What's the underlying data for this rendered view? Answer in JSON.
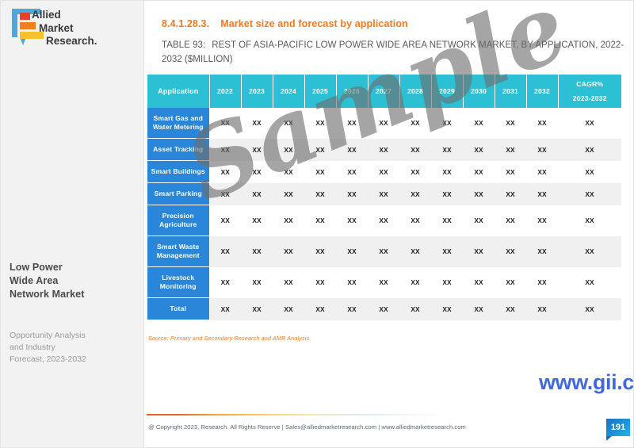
{
  "sidebar": {
    "logo": {
      "line1": "Allied",
      "line2": "Market",
      "line3": "Research."
    },
    "report_title_line1": "Low Power",
    "report_title_line2": "Wide Area",
    "report_title_line3": "Network Market",
    "report_subtitle_line1": "Opportunity Analysis",
    "report_subtitle_line2": "and Industry",
    "report_subtitle_line3": "Forecast, 2023-2032"
  },
  "main": {
    "section_number": "8.4.1.28.3.",
    "section_title": "Market size and forecast by application",
    "table_number": "TABLE 93:",
    "table_caption": "REST OF ASIA-PACIFIC LOW POWER WIDE AREA NETWORK MARKET, BY APPLICATION, 2022-2032 ($MILLION)",
    "source_note": "Source: Primary and Secondary Research and AMR Analysis"
  },
  "table": {
    "columns": [
      "Application",
      "2022",
      "2023",
      "2024",
      "2025",
      "2026",
      "2027",
      "2028",
      "2029",
      "2030",
      "2031",
      "2032"
    ],
    "cagr_header_line1": "CAGR%",
    "cagr_header_line2": "2023-2032",
    "rows": [
      {
        "label": "Smart Gas and Water Metering",
        "values": [
          "XX",
          "XX",
          "XX",
          "XX",
          "XX",
          "XX",
          "XX",
          "XX",
          "XX",
          "XX",
          "XX",
          "XX"
        ]
      },
      {
        "label": "Asset Tracking",
        "values": [
          "XX",
          "XX",
          "XX",
          "XX",
          "XX",
          "XX",
          "XX",
          "XX",
          "XX",
          "XX",
          "XX",
          "XX"
        ]
      },
      {
        "label": "Smart Buildings",
        "values": [
          "XX",
          "XX",
          "XX",
          "XX",
          "XX",
          "XX",
          "XX",
          "XX",
          "XX",
          "XX",
          "XX",
          "XX"
        ]
      },
      {
        "label": "Smart Parking",
        "values": [
          "XX",
          "XX",
          "XX",
          "XX",
          "XX",
          "XX",
          "XX",
          "XX",
          "XX",
          "XX",
          "XX",
          "XX"
        ]
      },
      {
        "label": "Precision Agriculture",
        "values": [
          "XX",
          "XX",
          "XX",
          "XX",
          "XX",
          "XX",
          "XX",
          "XX",
          "XX",
          "XX",
          "XX",
          "XX"
        ]
      },
      {
        "label": "Smart Waste Management",
        "values": [
          "XX",
          "XX",
          "XX",
          "XX",
          "XX",
          "XX",
          "XX",
          "XX",
          "XX",
          "XX",
          "XX",
          "XX"
        ]
      },
      {
        "label": "Livestock Monitoring",
        "values": [
          "XX",
          "XX",
          "XX",
          "XX",
          "XX",
          "XX",
          "XX",
          "XX",
          "XX",
          "XX",
          "XX",
          "XX"
        ]
      },
      {
        "label": "Total",
        "values": [
          "XX",
          "XX",
          "XX",
          "XX",
          "XX",
          "XX",
          "XX",
          "XX",
          "XX",
          "XX",
          "XX",
          "XX"
        ]
      }
    ]
  },
  "watermarks": {
    "sample_text": "Sample",
    "gii_url": "www.gii.co.jp"
  },
  "footer": {
    "copyright": "@ Copyright 2023, Research. All Rights Reserve | Sales@alliedmarketresearch.com | www.alliedmarketresearch.com",
    "page_number": "191"
  },
  "colors": {
    "header_teal": "#2cc0d5",
    "row_label_blue": "#2a86d8",
    "accent_orange": "#f47920",
    "gii_blue": "#4169dd",
    "alt_row_gray": "#f0f0f0"
  }
}
